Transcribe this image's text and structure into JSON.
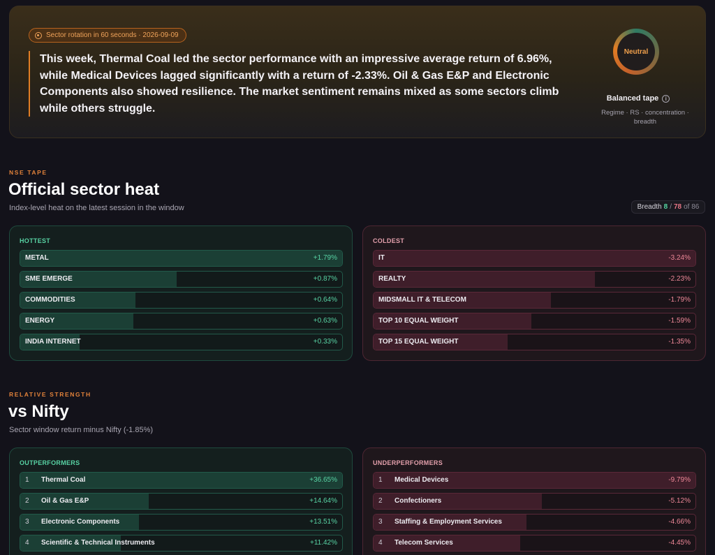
{
  "hero": {
    "pill_text": "Sector rotation in 60 seconds · 2026-09-09",
    "summary": "This week, Thermal Coal led the sector performance with an impressive average return of 6.96%, while Medical Devices lagged significantly with a return of -2.33%. Oil & Gas E&P and Electronic Components also showed resilience. The market sentiment remains mixed as some sectors climb while others struggle.",
    "gauge_label": "Neutral",
    "tape_title": "Balanced tape",
    "tape_sub": "Regime · RS · concentration · breadth",
    "info_icon": "i"
  },
  "heat": {
    "eyebrow": "NSE TAPE",
    "title": "Official sector heat",
    "subtitle": "Index-level heat on the latest session in the window",
    "breadth": {
      "label": "Breadth",
      "up": "8",
      "down": "78",
      "sep1": "/",
      "of": "of 86"
    },
    "hottest": {
      "label": "HOTTEST",
      "items": [
        {
          "name": "METAL",
          "value": "+1.79%",
          "strength": 1.0
        },
        {
          "name": "SME EMERGE",
          "value": "+0.87%",
          "strength": 0.486
        },
        {
          "name": "COMMODITIES",
          "value": "+0.64%",
          "strength": 0.358
        },
        {
          "name": "ENERGY",
          "value": "+0.63%",
          "strength": 0.352
        },
        {
          "name": "INDIA INTERNET",
          "value": "+0.33%",
          "strength": 0.184
        }
      ]
    },
    "coldest": {
      "label": "COLDEST",
      "items": [
        {
          "name": "IT",
          "value": "-3.24%",
          "strength": 1.0
        },
        {
          "name": "REALTY",
          "value": "-2.23%",
          "strength": 0.688
        },
        {
          "name": "MIDSMALL IT & TELECOM",
          "value": "-1.79%",
          "strength": 0.552
        },
        {
          "name": "TOP 10 EQUAL WEIGHT",
          "value": "-1.59%",
          "strength": 0.491
        },
        {
          "name": "TOP 15 EQUAL WEIGHT",
          "value": "-1.35%",
          "strength": 0.417
        }
      ]
    }
  },
  "rs": {
    "eyebrow": "RELATIVE STRENGTH",
    "title": "vs Nifty",
    "subtitle": "Sector window return minus Nifty (-1.85%)",
    "outperformers": {
      "label": "OUTPERFORMERS",
      "items": [
        {
          "rank": "1",
          "name": "Thermal Coal",
          "value": "+36.65%",
          "strength": 1.0
        },
        {
          "rank": "2",
          "name": "Oil & Gas E&P",
          "value": "+14.64%",
          "strength": 0.399
        },
        {
          "rank": "3",
          "name": "Electronic Components",
          "value": "+13.51%",
          "strength": 0.369
        },
        {
          "rank": "4",
          "name": "Scientific & Technical Instruments",
          "value": "+11.42%",
          "strength": 0.312
        }
      ]
    },
    "underperformers": {
      "label": "UNDERPERFORMERS",
      "items": [
        {
          "rank": "1",
          "name": "Medical Devices",
          "value": "-9.79%",
          "strength": 1.0
        },
        {
          "rank": "2",
          "name": "Confectioners",
          "value": "-5.12%",
          "strength": 0.523
        },
        {
          "rank": "3",
          "name": "Staffing & Employment Services",
          "value": "-4.66%",
          "strength": 0.476
        },
        {
          "rank": "4",
          "name": "Telecom Services",
          "value": "-4.45%",
          "strength": 0.455
        }
      ]
    }
  }
}
